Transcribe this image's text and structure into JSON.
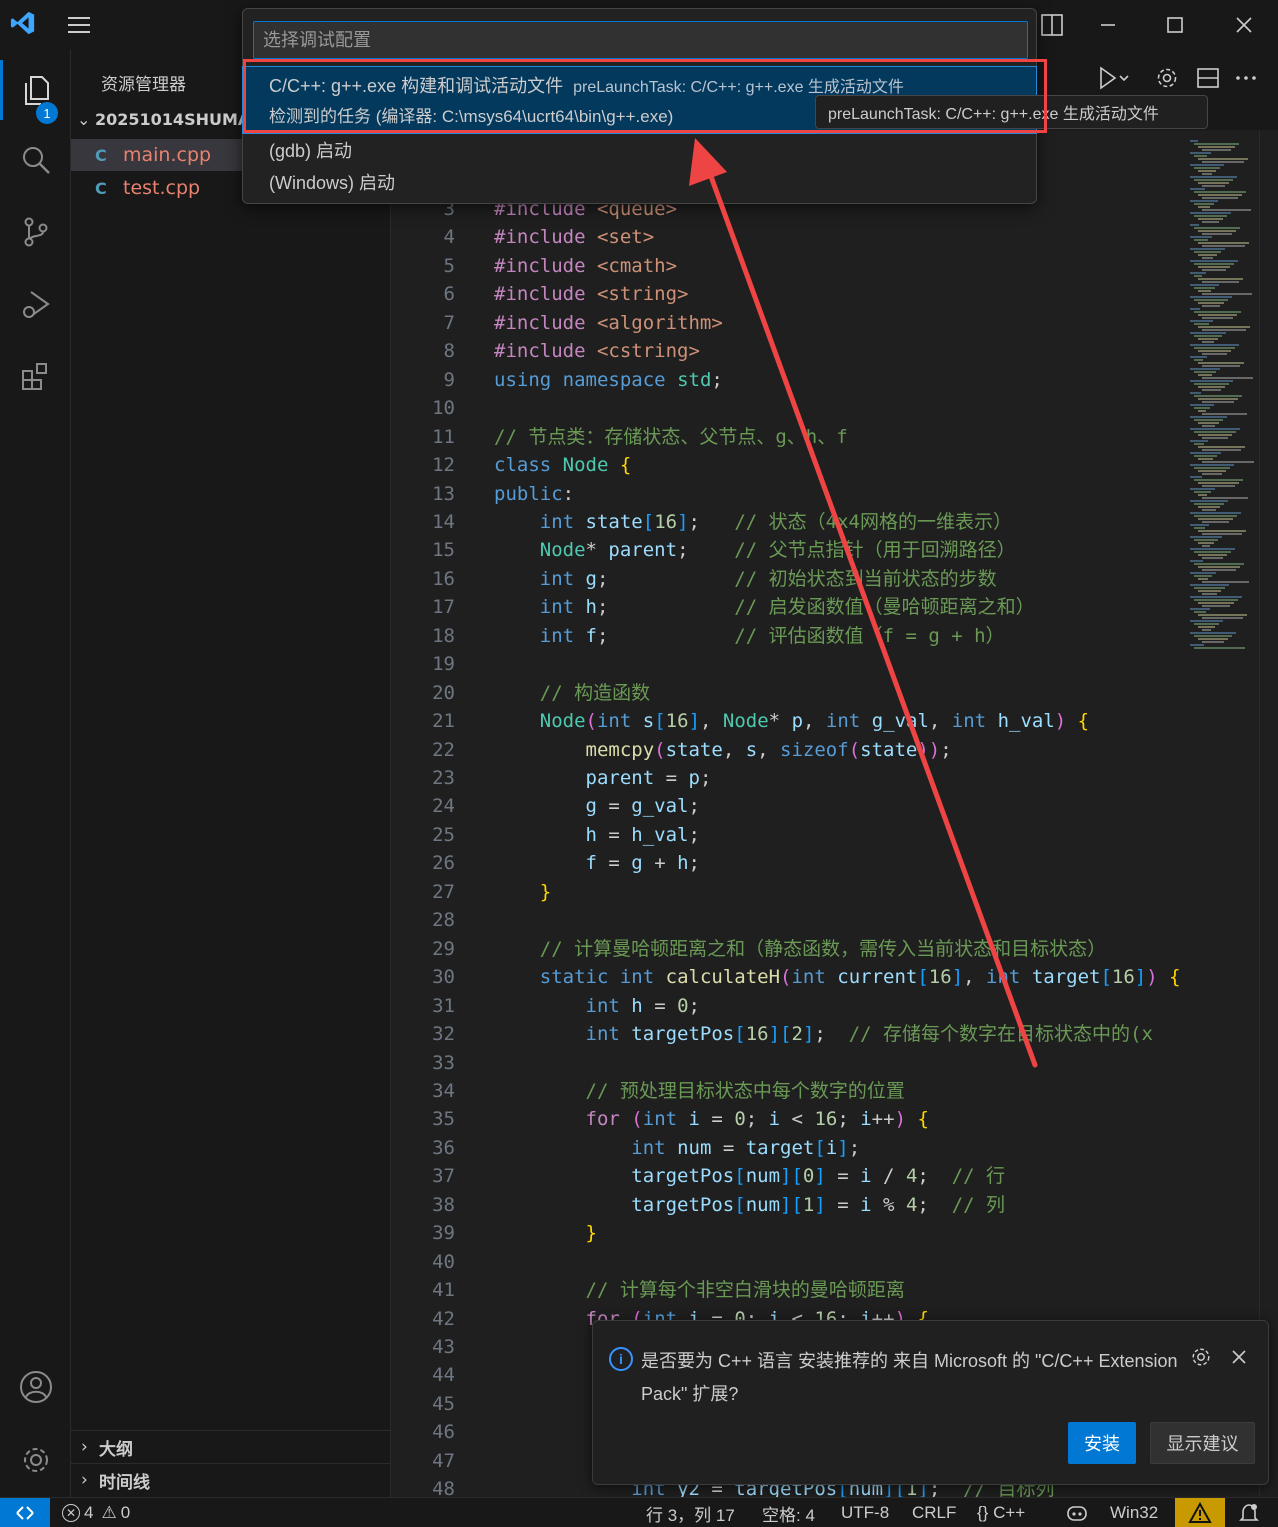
{
  "explorer": {
    "title": "资源管理器",
    "badge": "1",
    "folder": "20251014SHUMA",
    "files": [
      "main.cpp",
      "test.cpp"
    ],
    "file_icon": "C",
    "sections": [
      "大纲",
      "时间线"
    ]
  },
  "quickpick": {
    "placeholder": "选择调试配置",
    "items": [
      {
        "label": "C/C++: g++.exe 构建和调试活动文件",
        "description": "preLaunchTask: C/C++: g++.exe 生成活动文件",
        "detail": "检测到的任务 (编译器: C:\\msys64\\ucrt64\\bin\\g++.exe)"
      },
      {
        "label": "(gdb) 启动"
      },
      {
        "label": "(Windows) 启动"
      }
    ],
    "tooltip": "preLaunchTask: C/C++: g++.exe 生成活动文件"
  },
  "code": {
    "first_line": 3,
    "lines": [
      "#include <queue>",
      "#include <set>",
      "#include <cmath>",
      "#include <string>",
      "#include <algorithm>",
      "#include <cstring>",
      "using namespace std;",
      "",
      "// 节点类：存储状态、父节点、g、h、f",
      "class Node {",
      "public:",
      "    int state[16];   // 状态（4x4网格的一维表示）",
      "    Node* parent;    // 父节点指针（用于回溯路径）",
      "    int g;           // 初始状态到当前状态的步数",
      "    int h;           // 启发函数值（曼哈顿距离之和）",
      "    int f;           // 评估函数值（f = g + h）",
      "",
      "    // 构造函数",
      "    Node(int s[16], Node* p, int g_val, int h_val) {",
      "        memcpy(state, s, sizeof(state));",
      "        parent = p;",
      "        g = g_val;",
      "        h = h_val;",
      "        f = g + h;",
      "    }",
      "",
      "    // 计算曼哈顿距离之和（静态函数，需传入当前状态和目标状态）",
      "    static int calculateH(int current[16], int target[16]) {",
      "        int h = 0;",
      "        int targetPos[16][2];  // 存储每个数字在目标状态中的(x",
      "",
      "        // 预处理目标状态中每个数字的位置",
      "        for (int i = 0; i < 16; i++) {",
      "            int num = target[i];",
      "            targetPos[num][0] = i / 4;  // 行",
      "            targetPos[num][1] = i % 4;  // 列",
      "        }",
      "",
      "        // 计算每个非空白滑块的曼哈顿距离",
      "        for (int i = 0; i < 16; i++) {",
      "",
      "",
      "",
      "",
      "",
      "            int y2 = targetPos[num][1];  // 目标列"
    ]
  },
  "notification": {
    "message": "是否要为 C++ 语言 安装推荐的 来自 Microsoft 的 \"C/C++ Extension Pack\" 扩展?",
    "install": "安装",
    "suggest": "显示建议",
    "icon": "info-icon"
  },
  "statusbar": {
    "errors": "4",
    "warnings": "0",
    "position": "行 3，列 17",
    "spaces": "空格: 4",
    "encoding": "UTF-8",
    "eol": "CRLF",
    "language": "{} C++",
    "platform": "Win32"
  },
  "colors": {
    "accent": "#0078d4",
    "highlight_box": "#ef4444"
  }
}
